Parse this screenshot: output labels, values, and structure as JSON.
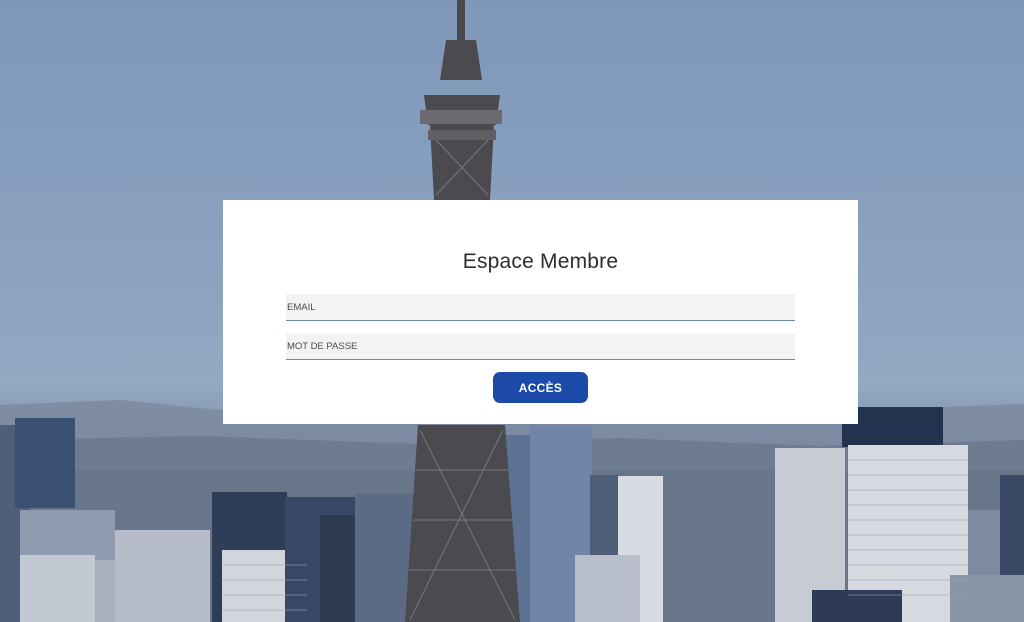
{
  "login": {
    "title": "Espace Membre",
    "email_placeholder": "EMAIL",
    "email_value": "",
    "password_placeholder": "MOT DE PASSE",
    "password_value": "",
    "submit_label": "ACCÈS"
  },
  "colors": {
    "button": "#1d4aa8",
    "field_background": "#f3f3f3",
    "field_underline": "#6b8bad",
    "card": "#ffffff"
  }
}
